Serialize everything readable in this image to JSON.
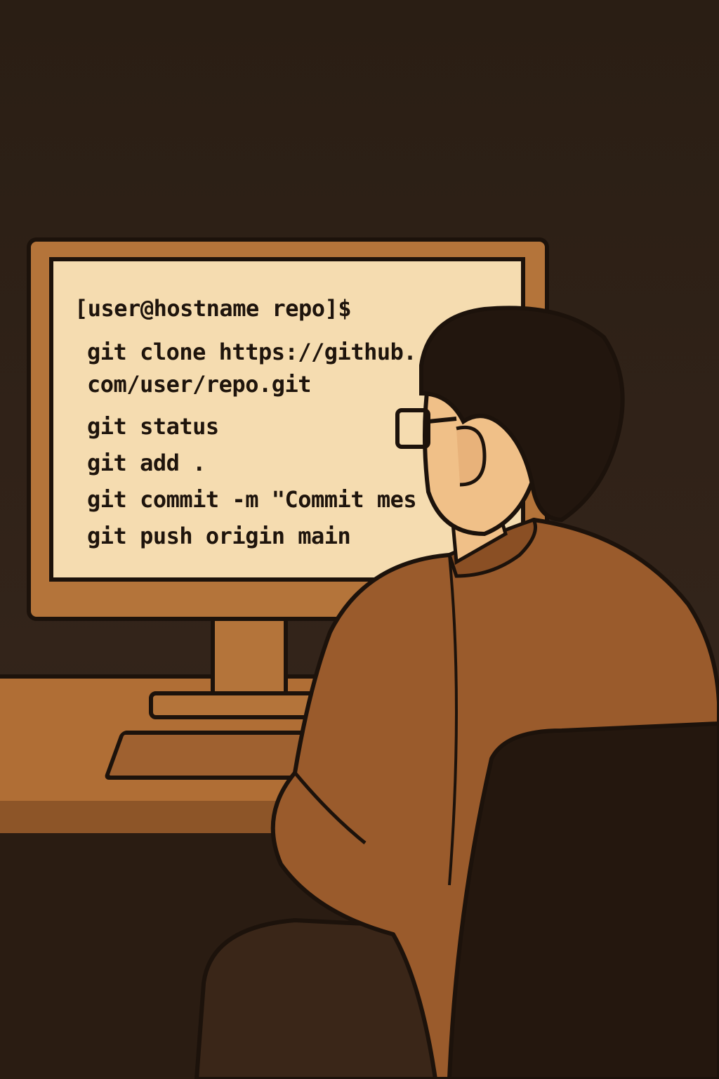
{
  "terminal": {
    "prompt": "[user@hostname repo]$",
    "lines": [
      "git clone https://github.",
      "com/user/repo.git",
      "git status",
      "git add .",
      "git commit -m  \"Commit mes",
      "git push origin main"
    ]
  },
  "colors": {
    "background": "#2e2016",
    "screen": "#f5dcb0",
    "frame": "#b4743a",
    "jacket": "#9a5b2c",
    "outline": "#1c120b"
  }
}
